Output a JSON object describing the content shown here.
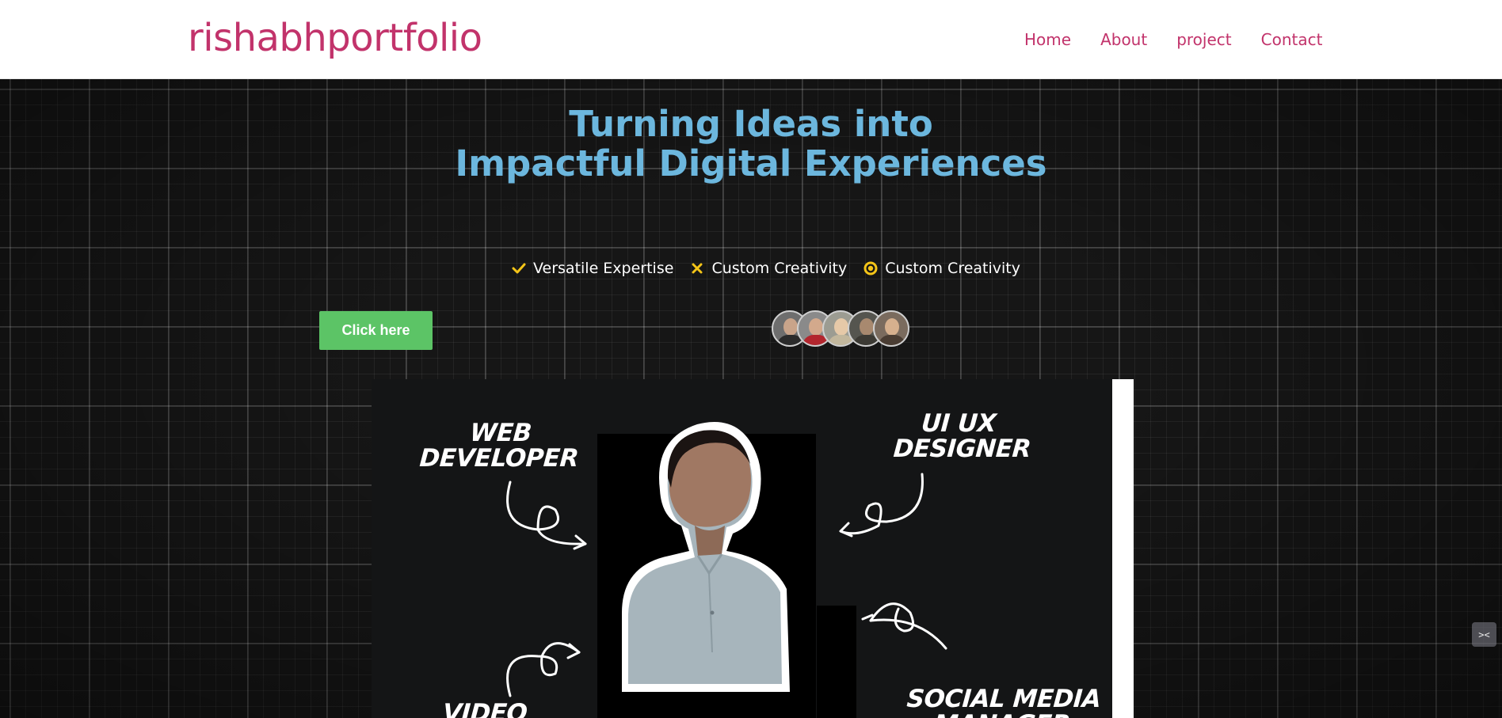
{
  "brand": "rishabhportfolio",
  "nav": [
    "Home",
    "About",
    "project",
    "Contact"
  ],
  "hero": {
    "headline_line1": "Turning Ideas into",
    "headline_line2": "Impactful Digital Experiences",
    "features": [
      {
        "icon": "check-icon",
        "label": "Versatile Expertise"
      },
      {
        "icon": "close-icon",
        "label": "Custom Creativity"
      },
      {
        "icon": "radio-dot-icon",
        "label": "Custom Creativity"
      }
    ],
    "cta_label": "Click here",
    "avatar_count": 5
  },
  "banner": {
    "labels": {
      "web": "WEB DEVELOPER",
      "uiux": "UI UX DESIGNER",
      "video": "VIDEO",
      "social": "SOCIAL MEDIA MANAGER"
    }
  },
  "colors": {
    "brand": "#c2336b",
    "headline": "#6cb7de",
    "accent_icon": "#f5c518",
    "cta": "#5cc466"
  }
}
